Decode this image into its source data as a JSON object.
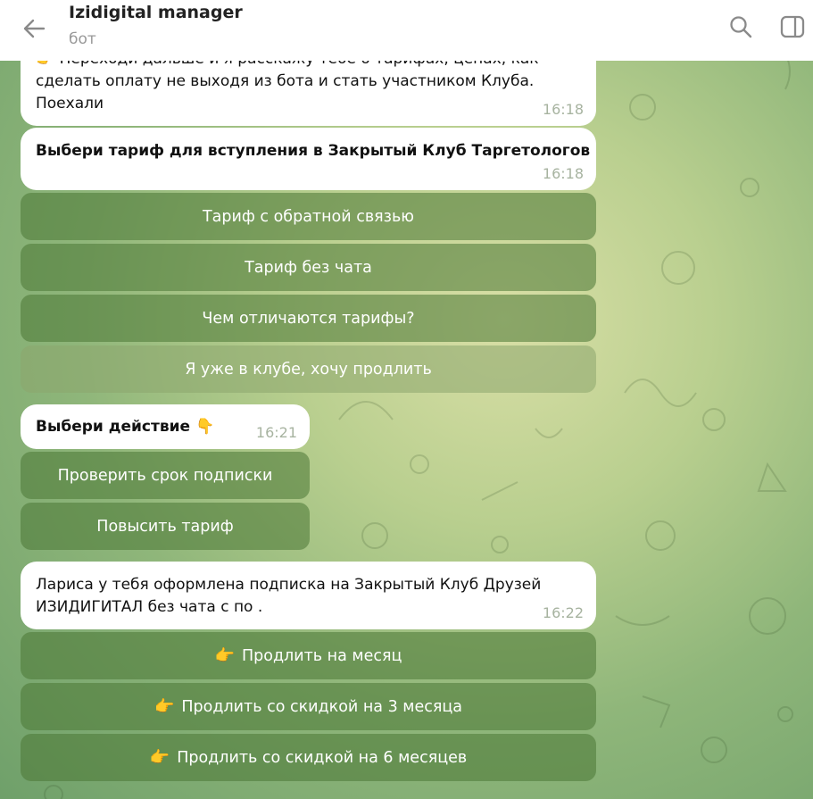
{
  "header": {
    "title": "Izidigital manager",
    "subtitle": "бот"
  },
  "messages": [
    {
      "text_cut": "👉 Переходи дальше и я расскажу тебе о тарифах, ценах, как",
      "text_l2": "сделать оплату не выходя из бота и стать участником Клуба.",
      "text_l3": "Поехали",
      "time": "16:18"
    },
    {
      "text": "Выбери тариф для вступления в Закрытый Клуб Таргетологов",
      "time": "16:18",
      "buttons": [
        "Тариф с обратной связью",
        "Тариф без чата",
        "Чем отличаются тарифы?",
        "Я уже в клубе, хочу продлить"
      ]
    },
    {
      "text": "Выбери действие 👇",
      "time": "16:21",
      "buttons": [
        "Проверить срок подписки",
        "Повысить тариф"
      ]
    },
    {
      "text_l1": "Лариса  у тебя оформлена подписка на Закрытый Клуб Друзей",
      "text_l2": "ИЗИДИГИТАЛ без чата с  по .",
      "time": "16:22",
      "buttons": [
        "Продлить на месяц",
        "Продлить со скидкой на 3 месяца",
        "Продлить со скидкой на 6 месяцев"
      ],
      "button_emoji": "👉"
    }
  ]
}
